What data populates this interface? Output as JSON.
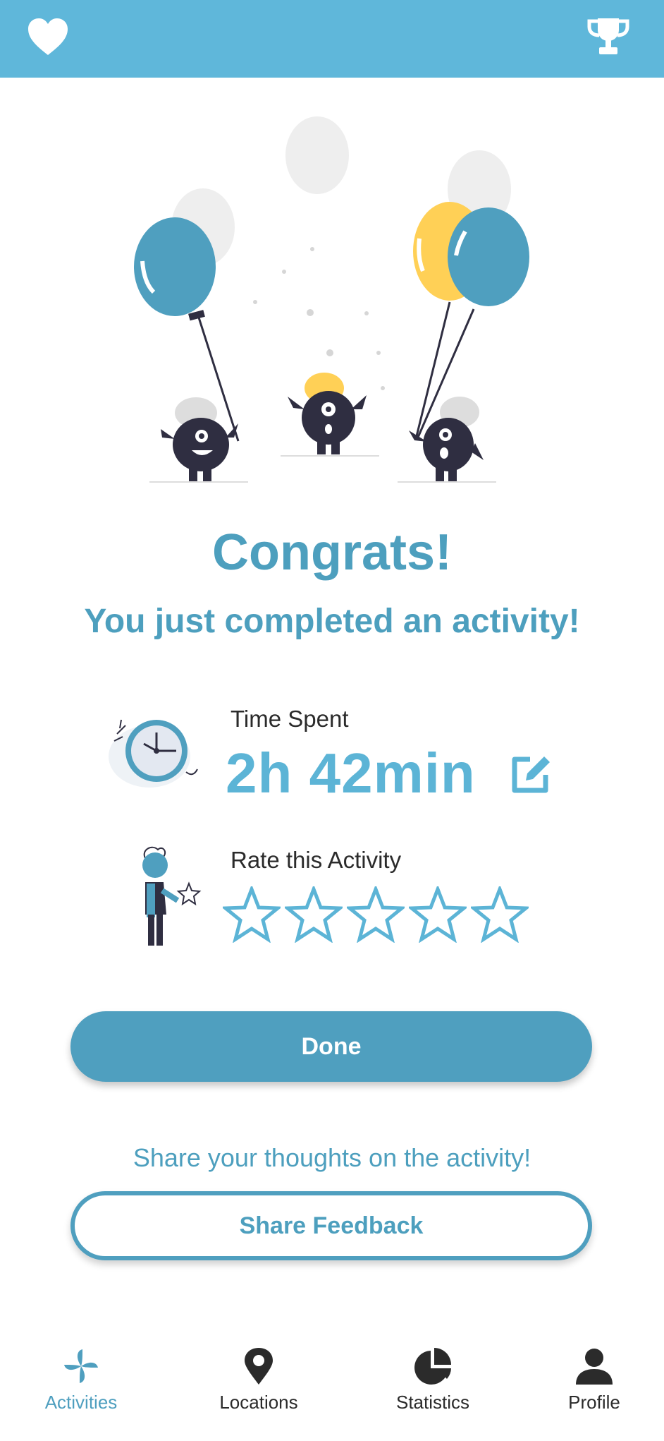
{
  "header": {
    "left_icon": "heart-icon",
    "right_icon": "trophy-icon",
    "bar_color": "#5fb7da"
  },
  "hero": {
    "illustration": "celebrating-monsters-with-balloons"
  },
  "main": {
    "title": "Congrats!",
    "subtitle": "You just completed an activity!",
    "time_spent_label": "Time Spent",
    "time_spent_value": "2h 42min",
    "edit_icon": "edit-icon",
    "rate_label": "Rate this Activity",
    "rating": 0,
    "rating_max": 5,
    "done_label": "Done",
    "share_caption": "Share your thoughts on the activity!",
    "feedback_label": "Share Feedback"
  },
  "nav": {
    "items": [
      {
        "label": "Activities",
        "icon": "pinwheel-icon",
        "active": true
      },
      {
        "label": "Locations",
        "icon": "map-pin-icon",
        "active": false
      },
      {
        "label": "Statistics",
        "icon": "pie-chart-icon",
        "active": false
      },
      {
        "label": "Profile",
        "icon": "user-icon",
        "active": false
      }
    ]
  },
  "colors": {
    "accent": "#4f9fbf",
    "accent_light": "#5cb4d6",
    "text_dark": "#2b2b2b"
  }
}
